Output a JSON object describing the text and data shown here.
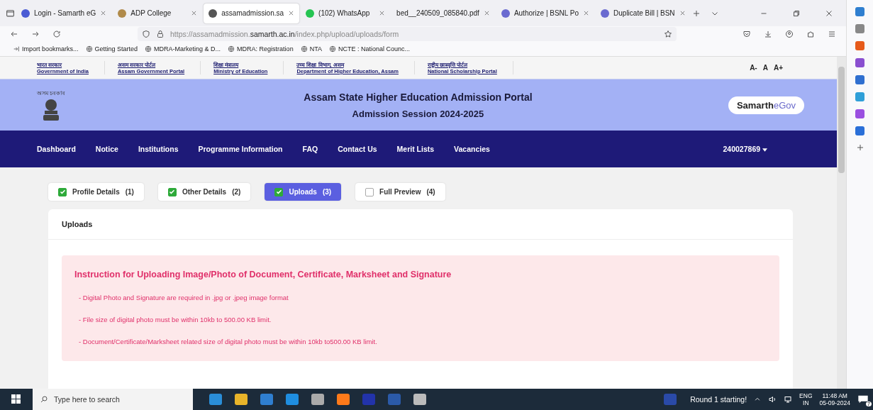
{
  "browser": {
    "tabs": [
      {
        "label": "Login - Samarth eG",
        "selected": false,
        "color": "#4a5bd4"
      },
      {
        "label": "ADP College",
        "selected": false,
        "color": "#b08a4a"
      },
      {
        "label": "assamadmission.sa",
        "selected": true,
        "color": "#555555"
      },
      {
        "label": "(102) WhatsApp",
        "selected": false,
        "color": "#25c452"
      },
      {
        "label": "bed__240509_085840.pdf",
        "selected": false
      },
      {
        "label": "Authorize | BSNL Po",
        "selected": false,
        "color": "#6a6ad0"
      },
      {
        "label": "Duplicate Bill | BSN",
        "selected": false,
        "color": "#6a6ad0"
      }
    ],
    "url": {
      "prefix": "https://assamadmission.",
      "host": "samarth.ac.in",
      "path": "/index.php/upload/uploads/form"
    },
    "bookmarks": [
      "Import bookmarks...",
      "Getting Started",
      "MDRA-Marketing & D...",
      "MDRA: Registration",
      "NTA",
      "NCTE : National Counc..."
    ]
  },
  "gov_links": [
    {
      "hindi": "भारत सरकार",
      "english": "Government of India"
    },
    {
      "hindi": "असम सरकार पोर्टल",
      "english": "Assam Government Portal"
    },
    {
      "hindi": "शिक्षा मंत्रालय",
      "english": "Ministry of Education"
    },
    {
      "hindi": "उच्च शिक्षा विभाग, असम",
      "english": "Department of Higher Education, Assam"
    },
    {
      "hindi": "राष्ट्रीय छात्रवृत्ति पोर्टल",
      "english": "National Scholarship Portal"
    }
  ],
  "font_sizes": [
    "A-",
    "A",
    "A+"
  ],
  "header": {
    "emblem_caption": "অসম চৰকাৰ",
    "title": "Assam State Higher Education Admission Portal",
    "subtitle": "Admission Session 2024-2025",
    "brand_bold": "Samarth",
    "brand_light": "eGov"
  },
  "nav": {
    "items": [
      "Dashboard",
      "Notice",
      "Institutions",
      "Programme Information",
      "FAQ",
      "Contact Us",
      "Merit Lists",
      "Vacancies"
    ],
    "user": "240027869"
  },
  "form_tabs": [
    {
      "label": "Profile Details",
      "count": "(1)",
      "checked": true,
      "selected": false
    },
    {
      "label": "Other Details",
      "count": "(2)",
      "checked": true,
      "selected": false
    },
    {
      "label": "Uploads",
      "count": "(3)",
      "checked": true,
      "selected": true
    },
    {
      "label": "Full Preview",
      "count": "(4)",
      "checked": false,
      "selected": false
    }
  ],
  "card": {
    "title": "Uploads",
    "instructions": {
      "title": "Instruction for Uploading Image/Photo of Document, Certificate, Marksheet and Signature",
      "items": [
        "- Digital Photo and Signature are required in .jpg or .jpeg image format",
        "- File size of digital photo must be within 10kb to 500.00 KB limit.",
        "- Document/Certificate/Marksheet related size of digital photo must be within 10kb to500.00 KB limit."
      ]
    }
  },
  "taskbar": {
    "search_placeholder": "Type here to search",
    "notification": "Round 1 starting!",
    "lang": "ENG",
    "region": "IN",
    "time": "11:48 AM",
    "date": "05-09-2024",
    "badge": "7"
  }
}
